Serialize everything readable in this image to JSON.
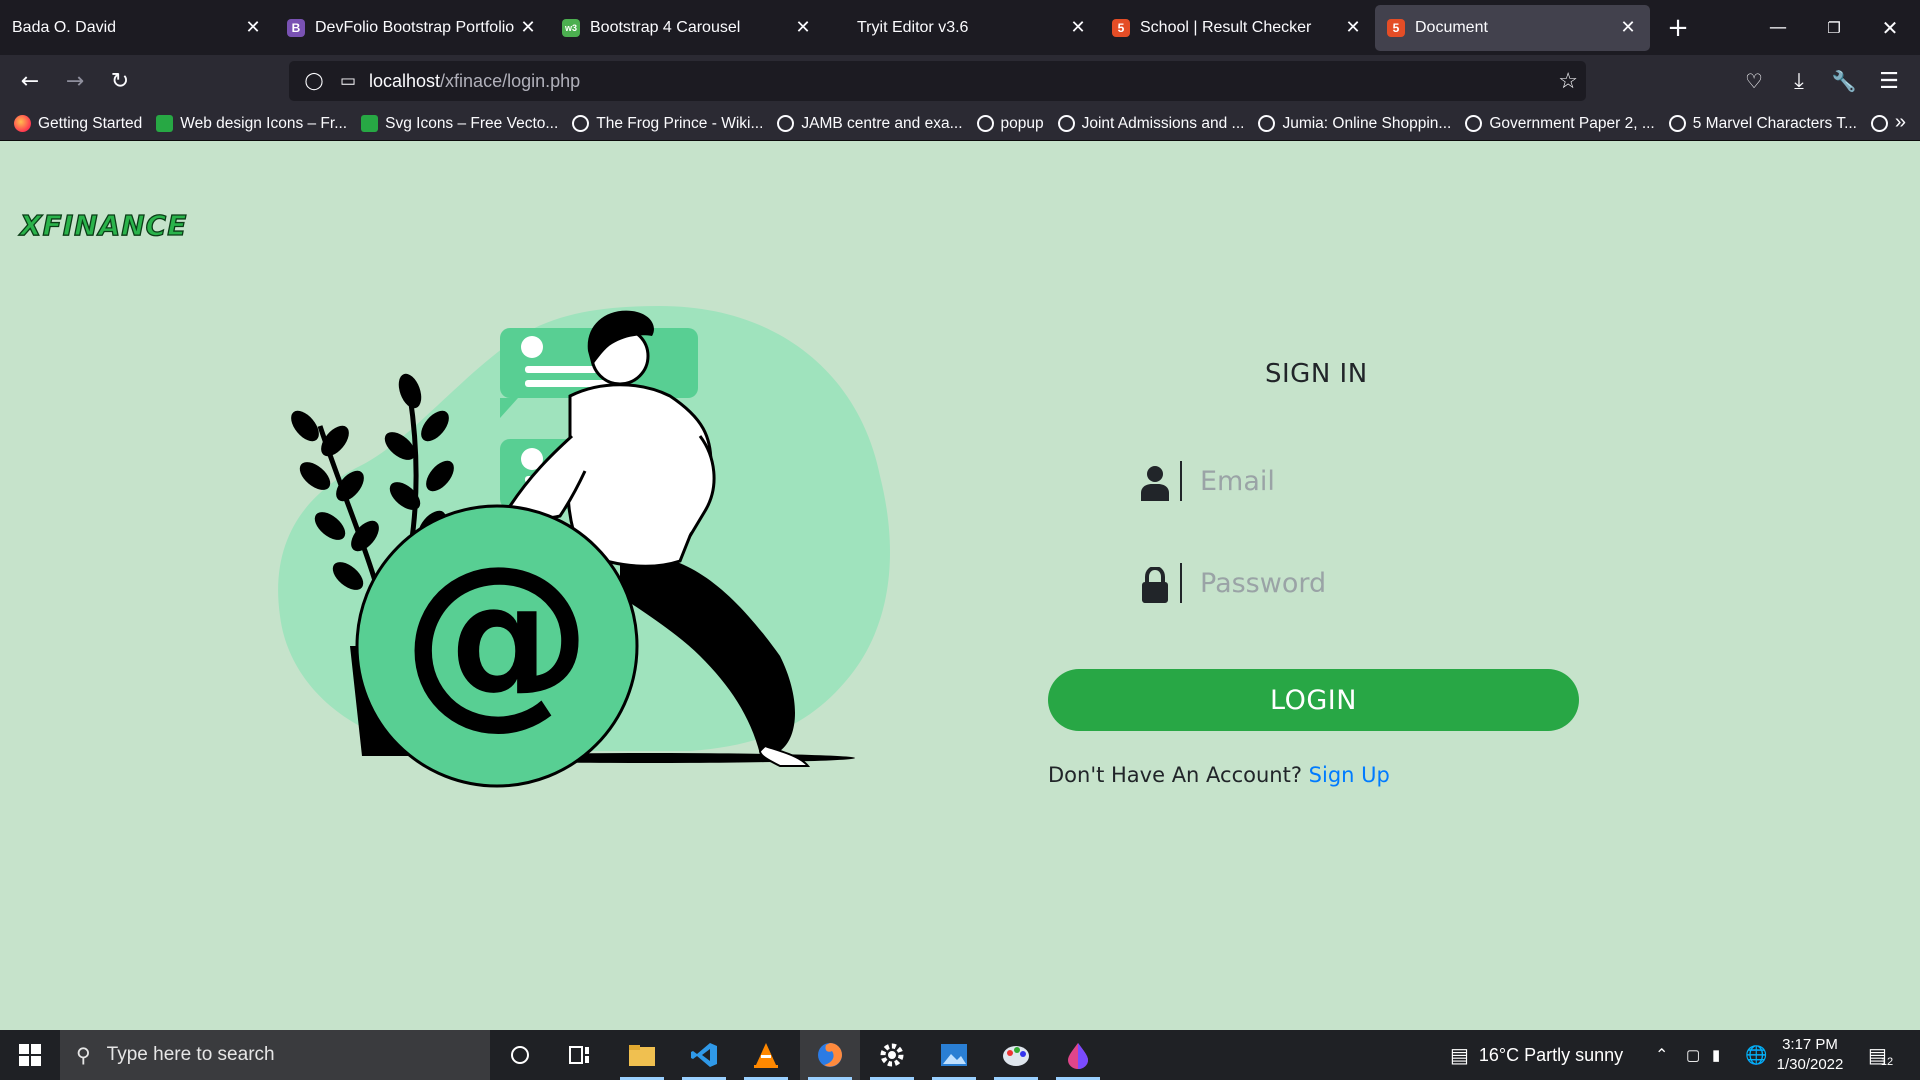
{
  "browser": {
    "tabs": [
      {
        "title": "Bada O. David",
        "close": "✕"
      },
      {
        "title": "DevFolio Bootstrap Portfolio Te",
        "close": "✕",
        "favicon_letter": "B"
      },
      {
        "title": "Bootstrap 4 Carousel",
        "close": "✕"
      },
      {
        "title": "Tryit Editor v3.6",
        "close": "✕"
      },
      {
        "title": "School | Result Checker",
        "close": "✕"
      },
      {
        "title": "Document",
        "close": "✕"
      }
    ],
    "new_tab": "+",
    "url_host": "localhost",
    "url_path": "/xfinace/login.php",
    "bookmarks": [
      "Getting Started",
      "Web design Icons – Fr...",
      "Svg Icons – Free Vecto...",
      "The Frog Prince - Wiki...",
      "JAMB centre  and exa...",
      "popup",
      "Joint Admissions and ...",
      "Jumia: Online Shoppin...",
      "Government Paper 2, ...",
      "5 Marvel Characters T..."
    ],
    "bookmarks_more": "»"
  },
  "page": {
    "logo": "XFINANCE",
    "signin_title": "SIGN IN",
    "email_placeholder": "Email",
    "password_placeholder": "Password",
    "login_label": "LOGIN",
    "no_account_text": "Don't Have An Account?",
    "signup_link": "Sign Up"
  },
  "taskbar": {
    "search_placeholder": "Type here to search",
    "weather": "16°C  Partly sunny",
    "time": "3:17 PM",
    "date": "1/30/2022",
    "notifications_count": "12"
  },
  "colors": {
    "page_bg": "#c6e3cb",
    "login_button": "#28a745",
    "link": "#007bff",
    "logo": "#2ab34b",
    "illustration_green": "#5ce0a3"
  }
}
